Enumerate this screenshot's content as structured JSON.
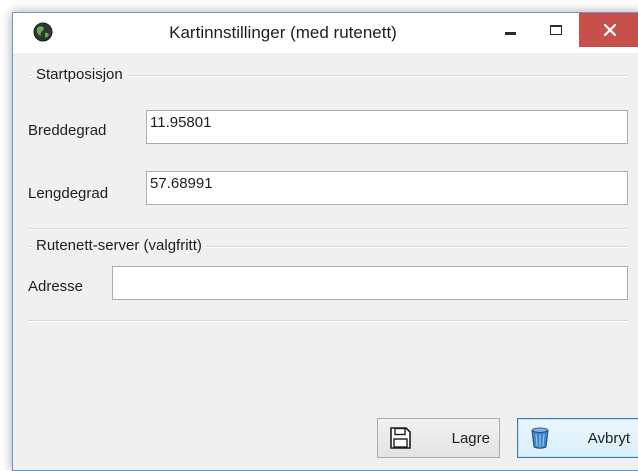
{
  "window": {
    "title": "Kartinnstillinger (med rutenett)",
    "accent_close": "#c7504a"
  },
  "start_position": {
    "heading": "Startposisjon",
    "latitude_label": "Breddegrad",
    "latitude_value": "11.95801",
    "longitude_label": "Lengdegrad",
    "longitude_value": "57.68991"
  },
  "grid_server": {
    "heading": "Rutenett-server (valgfritt)",
    "address_label": "Adresse",
    "address_value": ""
  },
  "buttons": {
    "save_label": "Lagre",
    "cancel_label": "Avbryt"
  },
  "icons": {
    "app": "globe-icon",
    "minimize": "minimize-icon",
    "maximize": "maximize-icon",
    "close": "close-icon",
    "save": "floppy-disk-icon",
    "cancel": "trash-can-icon"
  }
}
